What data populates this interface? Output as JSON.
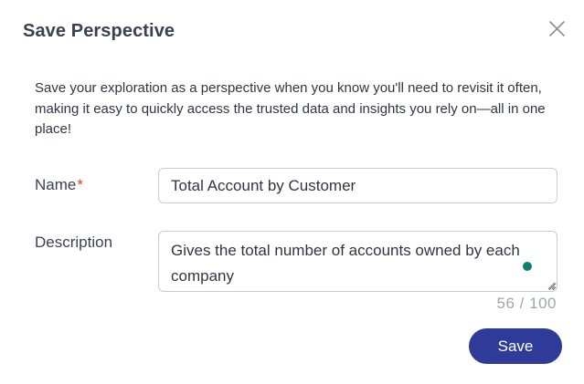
{
  "dialog": {
    "title": "Save Perspective",
    "intro": "Save your exploration as a perspective when you know you'll need to revisit it often, making it easy to quickly access the trusted data and insights you rely on—all in one place!",
    "close_icon": "close-icon"
  },
  "form": {
    "name_label": "Name",
    "required_marker": "*",
    "name_value": "Total Account by Customer",
    "description_label": "Description",
    "description_value": "Gives the total number of accounts owned by each company",
    "char_count": "56 / 100"
  },
  "actions": {
    "save_label": "Save"
  },
  "colors": {
    "primary": "#2f3b99",
    "required": "#e03b3b",
    "grammar_indicator": "#11806a"
  }
}
